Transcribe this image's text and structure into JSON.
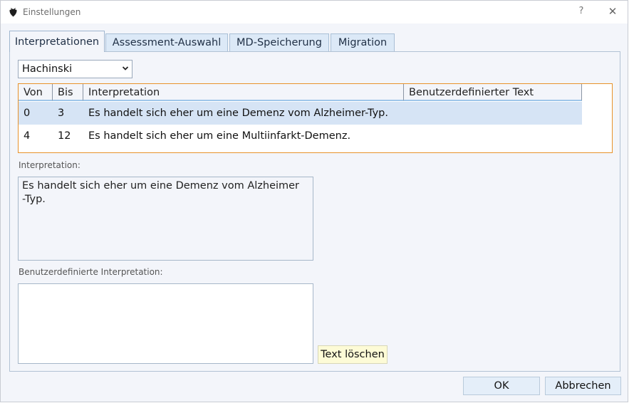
{
  "window": {
    "title": "Einstellungen",
    "help_label": "?",
    "close_label": "✕"
  },
  "tabs": [
    {
      "label": "Interpretationen",
      "active": true
    },
    {
      "label": "Assessment-Auswahl",
      "active": false
    },
    {
      "label": "MD-Speicherung",
      "active": false
    },
    {
      "label": "Migration",
      "active": false
    }
  ],
  "assessment_select": {
    "value": "Hachinski"
  },
  "table": {
    "columns": [
      "Von",
      "Bis",
      "Interpretation",
      "Benutzerdefinierter Text"
    ],
    "rows": [
      {
        "von": "0",
        "bis": "3",
        "interpretation": "Es handelt sich eher um eine Demenz vom Alzheimer-Typ.",
        "custom": "",
        "selected": true
      },
      {
        "von": "4",
        "bis": "12",
        "interpretation": "Es handelt sich eher um eine Multiinfarkt-Demenz.",
        "custom": "",
        "selected": false
      }
    ]
  },
  "interpretation": {
    "label": "Interpretation:",
    "text_line1": "Es handelt sich eher um eine Demenz vom Alzheimer",
    "text_line2": "-Typ."
  },
  "custom_interpretation": {
    "label": "Benutzerdefinierte Interpretation:",
    "value": ""
  },
  "buttons": {
    "clear_text": "Text löschen",
    "ok": "OK",
    "cancel": "Abbrechen"
  },
  "colors": {
    "table_border": "#e8922a",
    "selected_row": "#d6e4f5",
    "clear_button_bg": "#fdfbd6",
    "tab_bg": "#dce9f7"
  }
}
